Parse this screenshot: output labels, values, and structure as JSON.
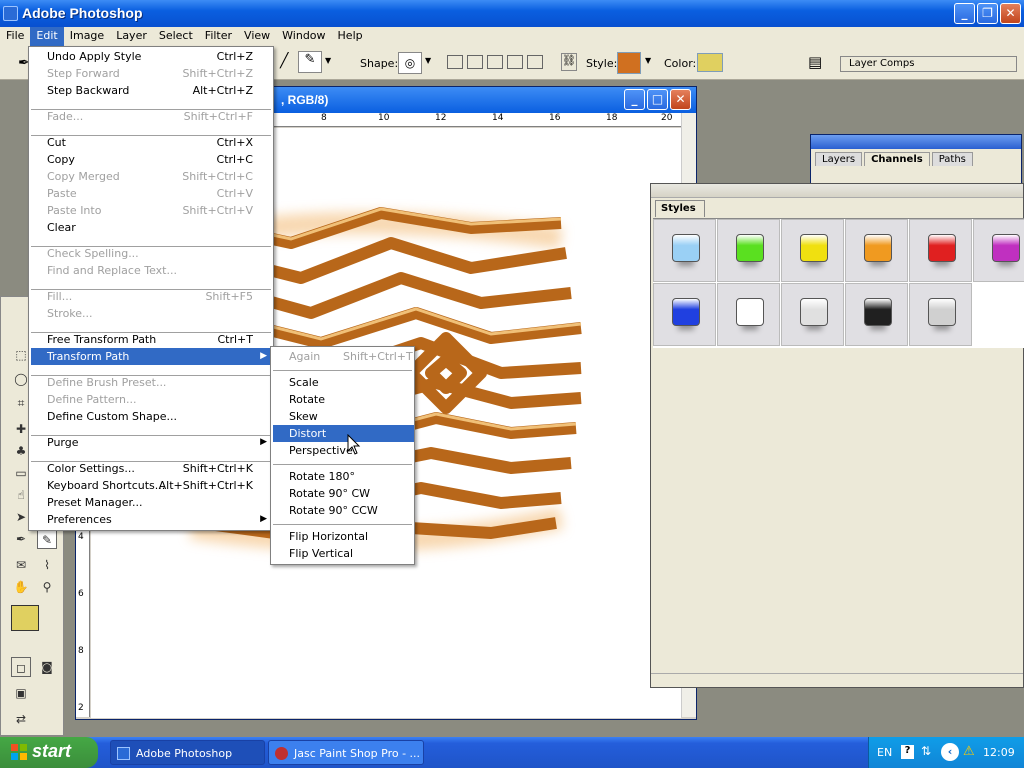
{
  "app": {
    "title": "Adobe Photoshop"
  },
  "menubar": [
    "File",
    "Edit",
    "Image",
    "Layer",
    "Select",
    "Filter",
    "View",
    "Window",
    "Help"
  ],
  "options": {
    "shape_label": "Shape:",
    "style_label": "Style:",
    "color_label": "Color:",
    "color_value": "#e0d060",
    "style_color": "#d07020",
    "layer_comps": "Layer Comps"
  },
  "document": {
    "title_suffix": ", RGB/8)",
    "ruler_top": [
      "8",
      "10",
      "12",
      "14",
      "16",
      "18",
      "20"
    ],
    "ruler_left": [
      "4",
      "6",
      "8",
      "2"
    ]
  },
  "layers_panel": {
    "tabs": [
      "Layers",
      "Channels",
      "Paths"
    ]
  },
  "styles_panel": {
    "tab": "Styles",
    "swatches": [
      "#9ad0f5",
      "#5ae020",
      "#f0e010",
      "#f09a20",
      "#e02020",
      "#c030c0",
      "#2040e0",
      "#ffffff",
      "#e0e0e0",
      "#202020",
      "#d0d0d0"
    ]
  },
  "edit_menu": {
    "items": [
      {
        "label": "Undo Apply Style",
        "shortcut": "Ctrl+Z",
        "disabled": false
      },
      {
        "label": "Step Forward",
        "shortcut": "Shift+Ctrl+Z",
        "disabled": true
      },
      {
        "label": "Step Backward",
        "shortcut": "Alt+Ctrl+Z",
        "disabled": false
      },
      {
        "label": "Fade...",
        "shortcut": "Shift+Ctrl+F",
        "disabled": true
      },
      {
        "label": "Cut",
        "shortcut": "Ctrl+X",
        "disabled": false
      },
      {
        "label": "Copy",
        "shortcut": "Ctrl+C",
        "disabled": false
      },
      {
        "label": "Copy Merged",
        "shortcut": "Shift+Ctrl+C",
        "disabled": true
      },
      {
        "label": "Paste",
        "shortcut": "Ctrl+V",
        "disabled": true
      },
      {
        "label": "Paste Into",
        "shortcut": "Shift+Ctrl+V",
        "disabled": true
      },
      {
        "label": "Clear",
        "shortcut": "",
        "disabled": false
      },
      {
        "label": "Check Spelling...",
        "shortcut": "",
        "disabled": true
      },
      {
        "label": "Find and Replace Text...",
        "shortcut": "",
        "disabled": true
      },
      {
        "label": "Fill...",
        "shortcut": "Shift+F5",
        "disabled": true
      },
      {
        "label": "Stroke...",
        "shortcut": "",
        "disabled": true
      },
      {
        "label": "Free Transform Path",
        "shortcut": "Ctrl+T",
        "disabled": false
      },
      {
        "label": "Transform Path",
        "shortcut": "",
        "disabled": false
      },
      {
        "label": "Define Brush Preset...",
        "shortcut": "",
        "disabled": true
      },
      {
        "label": "Define Pattern...",
        "shortcut": "",
        "disabled": true
      },
      {
        "label": "Define Custom Shape...",
        "shortcut": "",
        "disabled": false
      },
      {
        "label": "Purge",
        "shortcut": "",
        "disabled": false
      },
      {
        "label": "Color Settings...",
        "shortcut": "Shift+Ctrl+K",
        "disabled": false
      },
      {
        "label": "Keyboard Shortcuts...",
        "shortcut": "Alt+Shift+Ctrl+K",
        "disabled": false
      },
      {
        "label": "Preset Manager...",
        "shortcut": "",
        "disabled": false
      },
      {
        "label": "Preferences",
        "shortcut": "",
        "disabled": false
      }
    ]
  },
  "transform_menu": {
    "items": [
      {
        "label": "Again",
        "shortcut": "Shift+Ctrl+T",
        "disabled": true
      },
      {
        "label": "Scale",
        "shortcut": "",
        "disabled": false
      },
      {
        "label": "Rotate",
        "shortcut": "",
        "disabled": false
      },
      {
        "label": "Skew",
        "shortcut": "",
        "disabled": false
      },
      {
        "label": "Distort",
        "shortcut": "",
        "disabled": false
      },
      {
        "label": "Perspective",
        "shortcut": "",
        "disabled": false
      },
      {
        "label": "Rotate 180°",
        "shortcut": "",
        "disabled": false
      },
      {
        "label": "Rotate 90° CW",
        "shortcut": "",
        "disabled": false
      },
      {
        "label": "Rotate 90° CCW",
        "shortcut": "",
        "disabled": false
      },
      {
        "label": "Flip Horizontal",
        "shortcut": "",
        "disabled": false
      },
      {
        "label": "Flip Vertical",
        "shortcut": "",
        "disabled": false
      }
    ]
  },
  "taskbar": {
    "start": "start",
    "items": [
      "Adobe Photoshop",
      "Jasc Paint Shop Pro - ..."
    ],
    "lang": "EN",
    "clock": "12:09"
  }
}
